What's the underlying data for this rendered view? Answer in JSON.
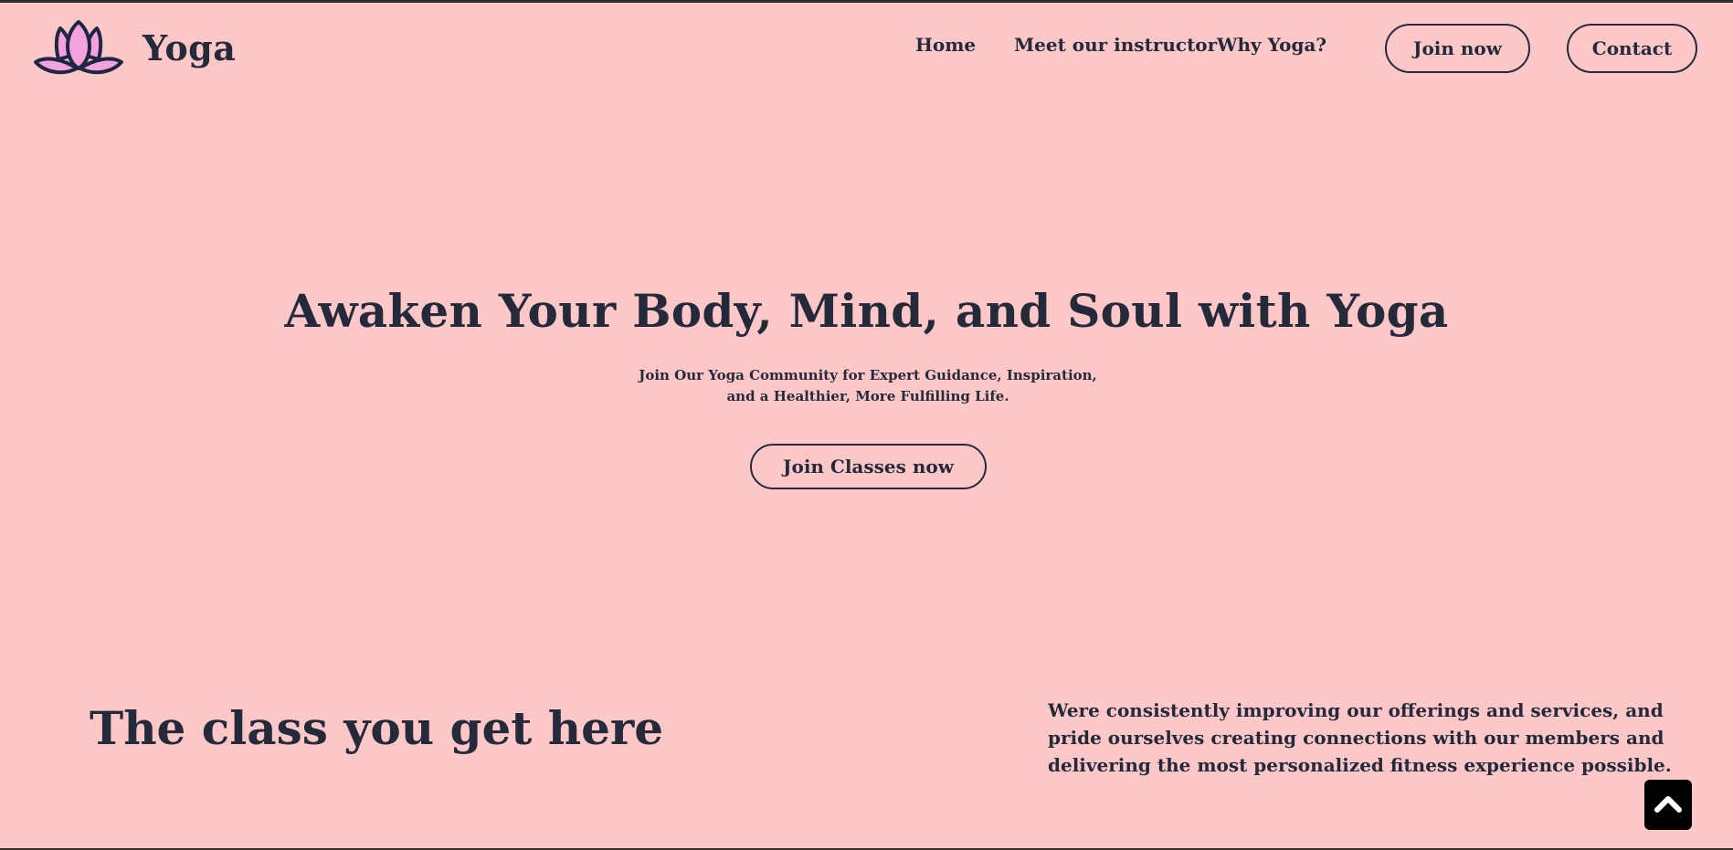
{
  "brand": {
    "name": "Yoga",
    "logo_icon": "lotus-icon",
    "logo_fill": "#f5a3dd",
    "logo_stroke": "#1f2641"
  },
  "nav": {
    "links": [
      {
        "label": "Home"
      },
      {
        "label": "Meet our instructor"
      },
      {
        "label": "Why Yoga?"
      }
    ],
    "join_label": "Join now",
    "contact_label": "Contact"
  },
  "hero": {
    "title": "Awaken Your Body, Mind, and Soul with Yoga",
    "subtitle": "Join Our Yoga Community for Expert Guidance, Inspiration, and a Healthier, More Fulfilling Life.",
    "cta_label": "Join Classes now"
  },
  "classes": {
    "title": "The class you get here",
    "description": "Were consistently improving our offerings and services, and pride ourselves creating connections with our members and delivering the most personalized fitness experience possible."
  },
  "scroll_top": {
    "icon": "chevron-up-icon"
  },
  "colors": {
    "background": "#ffc8c8",
    "text": "#252a3b",
    "accent": "#f5a3dd"
  }
}
